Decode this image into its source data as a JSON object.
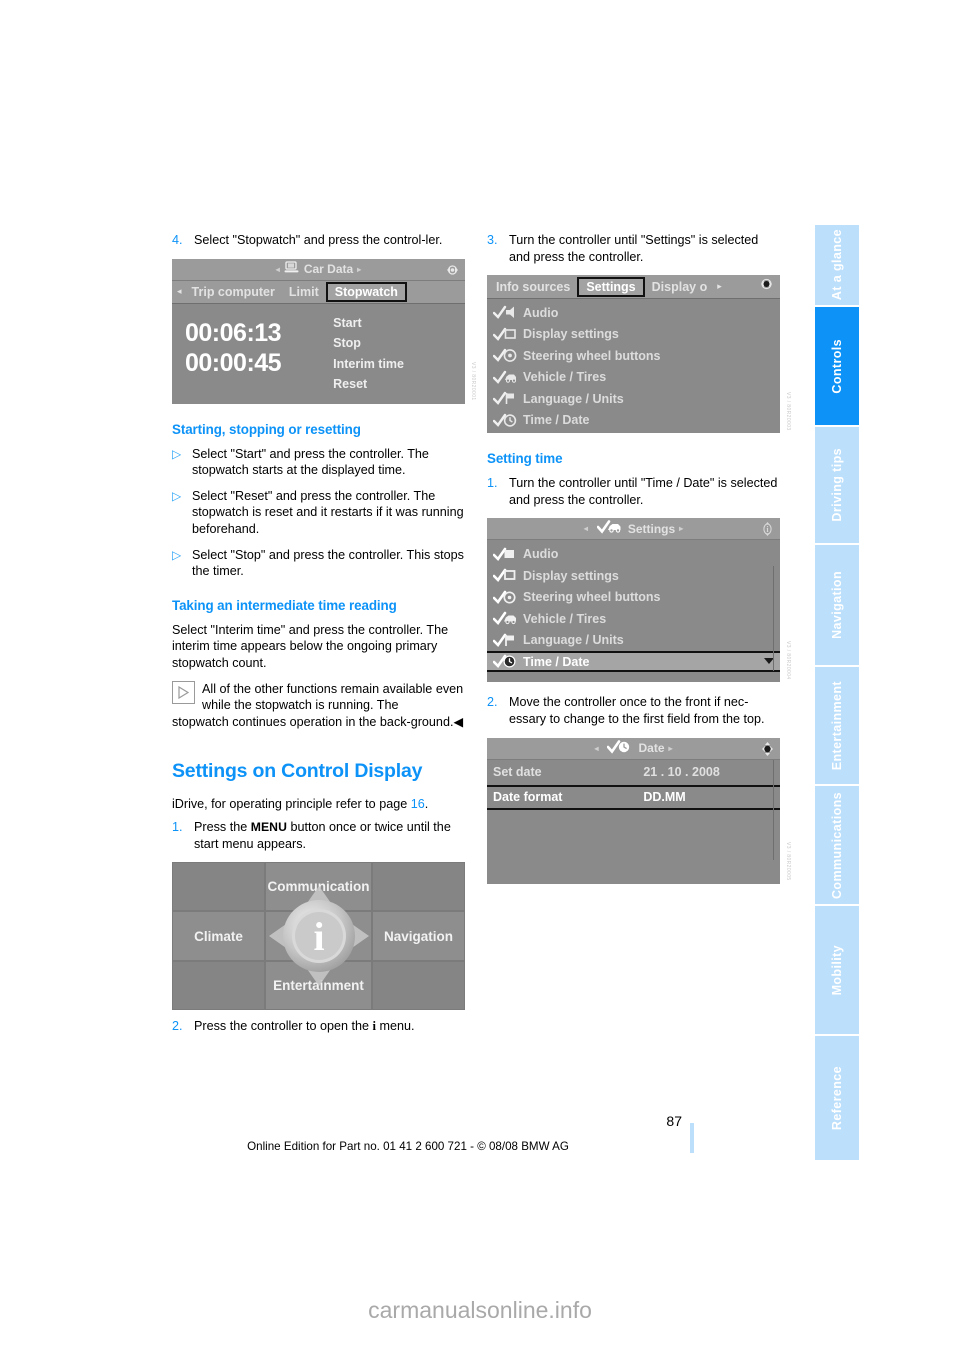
{
  "document": {
    "page_number": "87",
    "edition_line": "Online Edition for Part no. 01 41 2 600 721 - © 08/08 BMW AG",
    "watermark": "carmanualsonline.info",
    "accent_color": "#0d93f7",
    "tab_color": "#bcdffb"
  },
  "sidebar": {
    "tabs": [
      {
        "label": "At a glance",
        "active": false
      },
      {
        "label": "Controls",
        "active": true
      },
      {
        "label": "Driving tips",
        "active": false
      },
      {
        "label": "Navigation",
        "active": false
      },
      {
        "label": "Entertainment",
        "active": false
      },
      {
        "label": "Communications",
        "active": false
      },
      {
        "label": "Mobility",
        "active": false
      },
      {
        "label": "Reference",
        "active": false
      }
    ]
  },
  "left_column": {
    "step4": {
      "num": "4.",
      "text": "Select \"Stopwatch\" and press the control-ler."
    },
    "stopwatch_screen": {
      "title": "Car Data",
      "title_icon": "computer-icon",
      "tabs": [
        "Trip computer",
        "Limit",
        "Stopwatch"
      ],
      "selected_tab": "Stopwatch",
      "times": [
        "00:06:13",
        "00:00:45"
      ],
      "options": [
        "Start",
        "Stop",
        "Interim time",
        "Reset"
      ],
      "code": "V3 / 80R20001"
    },
    "heading_start_stop": "Starting, stopping or resetting",
    "bullets": [
      "Select \"Start\" and press the controller. The stopwatch starts at the displayed time.",
      "Select \"Reset\" and press the controller. The stopwatch is reset and it restarts if it was running beforehand.",
      "Select \"Stop\" and press the controller. This stops the timer."
    ],
    "heading_interim": "Taking an intermediate time reading",
    "interim_body": "Select \"Interim time\" and press the controller. The interim time appears below the ongoing primary stopwatch count.",
    "note_text": "All of the other functions remain available even while the stopwatch is running. The",
    "note_cont": "stopwatch continues operation in the back-ground.",
    "heading_settings": "Settings on Control Display",
    "idrive_line_pre": "iDrive, for operating principle refer to page ",
    "idrive_page_ref": "16",
    "idrive_line_post": ".",
    "step1": {
      "num": "1.",
      "pre": "Press the ",
      "key": "MENU",
      "post": " button once or twice until the start menu appears."
    },
    "start_menu_screen": {
      "cells": [
        "Communication",
        "Climate",
        "Navigation",
        "Entertainment"
      ],
      "center_icon": "i-controller-icon",
      "code": "V3 / 80R20002"
    },
    "step2": {
      "num": "2.",
      "pre": "Press the controller to open the ",
      "key": "i",
      "post": " menu."
    }
  },
  "right_column": {
    "step3": {
      "num": "3.",
      "text": "Turn the controller until \"Settings\" is selected and press the controller."
    },
    "settings_tabs_screen": {
      "tabs": [
        "Info sources",
        "Settings",
        "Display o"
      ],
      "selected_tab": "Settings",
      "items": [
        {
          "label": "Audio",
          "icon": "check-speaker-icon"
        },
        {
          "label": "Display settings",
          "icon": "check-display-icon"
        },
        {
          "label": "Steering wheel buttons",
          "icon": "check-steeringwheel-icon"
        },
        {
          "label": "Vehicle / Tires",
          "icon": "check-car-icon"
        },
        {
          "label": "Language / Units",
          "icon": "check-flag-icon"
        },
        {
          "label": "Time / Date",
          "icon": "check-clock-icon"
        }
      ],
      "code": "V3 / 80R20003"
    },
    "heading_setting_time": "Setting time",
    "step1": {
      "num": "1.",
      "text": "Turn the controller until \"Time / Date\" is selected and press the controller."
    },
    "settings_list_screen": {
      "title": "Settings",
      "title_icon": "check-car-icon",
      "items": [
        {
          "label": "Audio",
          "icon": "check-speaker-icon",
          "selected": false
        },
        {
          "label": "Display settings",
          "icon": "check-display-icon",
          "selected": false
        },
        {
          "label": "Steering wheel buttons",
          "icon": "check-steeringwheel-icon",
          "selected": false
        },
        {
          "label": "Vehicle / Tires",
          "icon": "check-car-icon",
          "selected": false
        },
        {
          "label": "Language / Units",
          "icon": "check-flag-icon",
          "selected": false
        },
        {
          "label": "Time / Date",
          "icon": "check-clock-icon",
          "selected": true
        }
      ],
      "code": "V3 / 80R20004"
    },
    "step2": {
      "num": "2.",
      "text": "Move the controller once to the front if nec-essary to change to the first field from the top."
    },
    "date_screen": {
      "title": "Date",
      "title_icon": "check-clock-icon",
      "rows": [
        {
          "key": "Set date",
          "value": "21 . 10 . 2008",
          "selected": false
        },
        {
          "key": "Date format",
          "value": "DD.MM",
          "selected": true
        }
      ],
      "code": "V3 / 80R20005"
    }
  }
}
